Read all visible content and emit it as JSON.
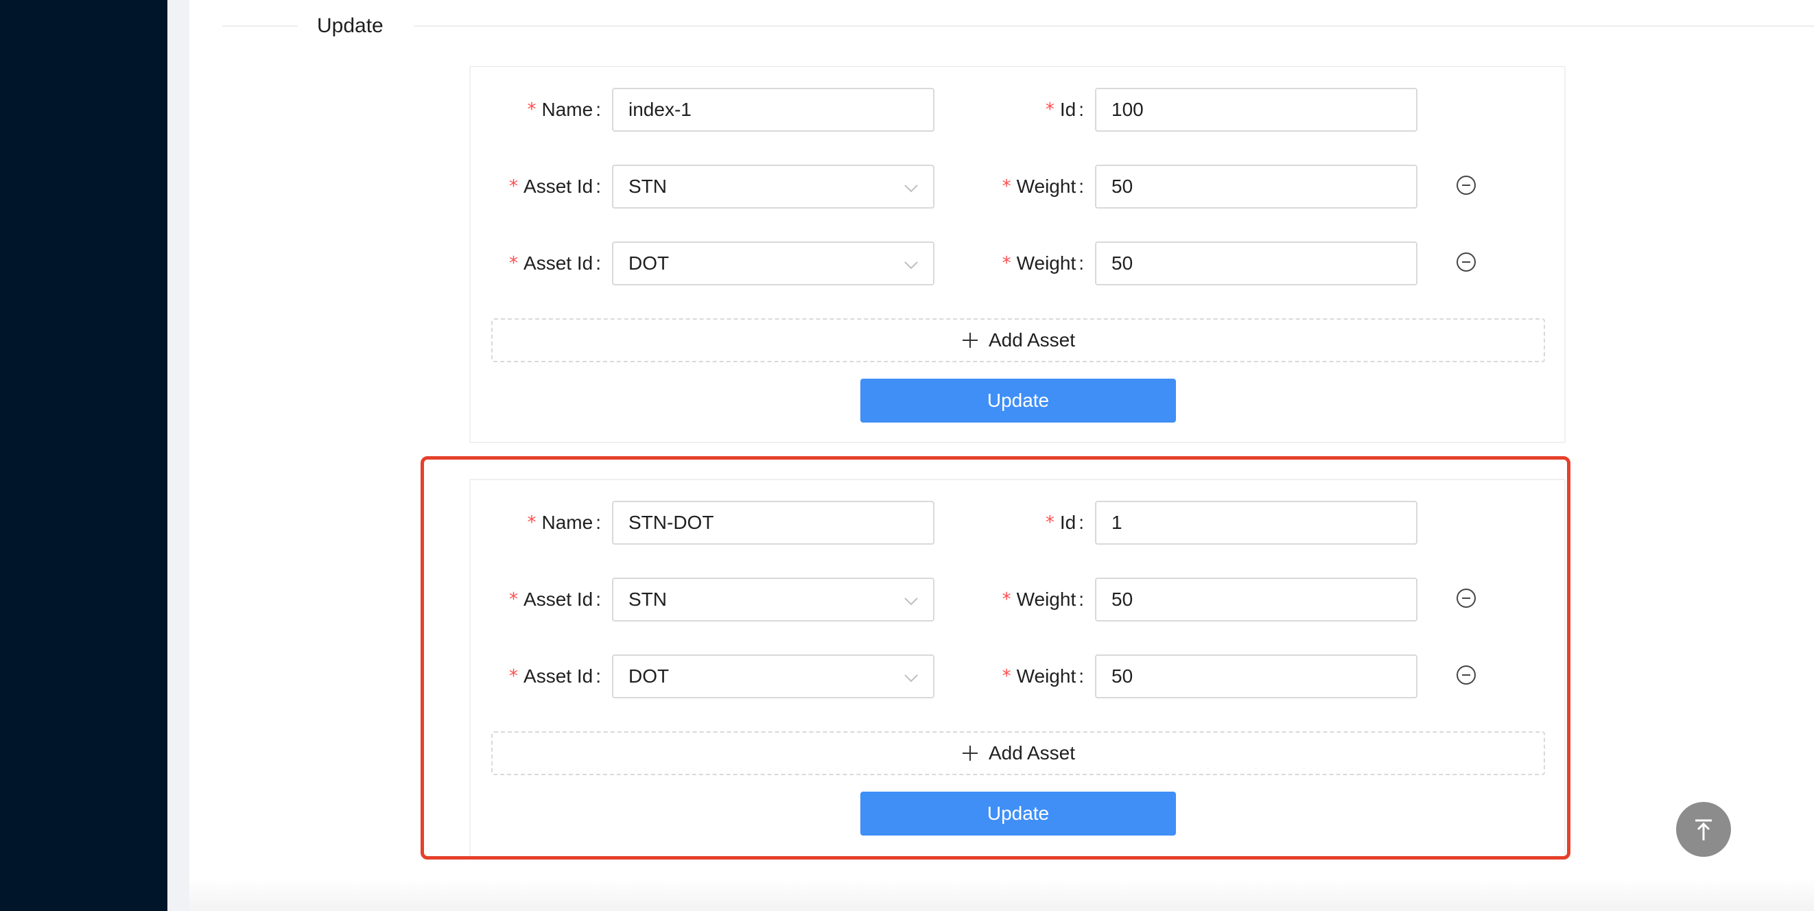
{
  "section": {
    "title": "Update"
  },
  "forms": [
    {
      "name_label": "Name",
      "name_value": "index-1",
      "id_label": "Id",
      "id_value": "100",
      "assets": [
        {
          "asset_label": "Asset Id",
          "asset_value": "STN",
          "weight_label": "Weight",
          "weight_value": "50"
        },
        {
          "asset_label": "Asset Id",
          "asset_value": "DOT",
          "weight_label": "Weight",
          "weight_value": "50"
        }
      ],
      "add_asset_label": "Add Asset",
      "submit_label": "Update"
    },
    {
      "name_label": "Name",
      "name_value": "STN-DOT",
      "id_label": "Id",
      "id_value": "1",
      "assets": [
        {
          "asset_label": "Asset Id",
          "asset_value": "STN",
          "weight_label": "Weight",
          "weight_value": "50"
        },
        {
          "asset_label": "Asset Id",
          "asset_value": "DOT",
          "weight_label": "Weight",
          "weight_value": "50"
        }
      ],
      "add_asset_label": "Add Asset",
      "submit_label": "Update"
    }
  ],
  "required_marker": "*",
  "icons": {
    "remove": "minus-circle-icon",
    "add": "plus-icon",
    "dropdown": "chevron-down-icon",
    "back_to_top": "vertical-align-top-icon"
  },
  "colors": {
    "sidebar": "#001529",
    "primary": "#3f8ff7",
    "required": "#ff4d4f",
    "highlight": "#e5402b"
  }
}
